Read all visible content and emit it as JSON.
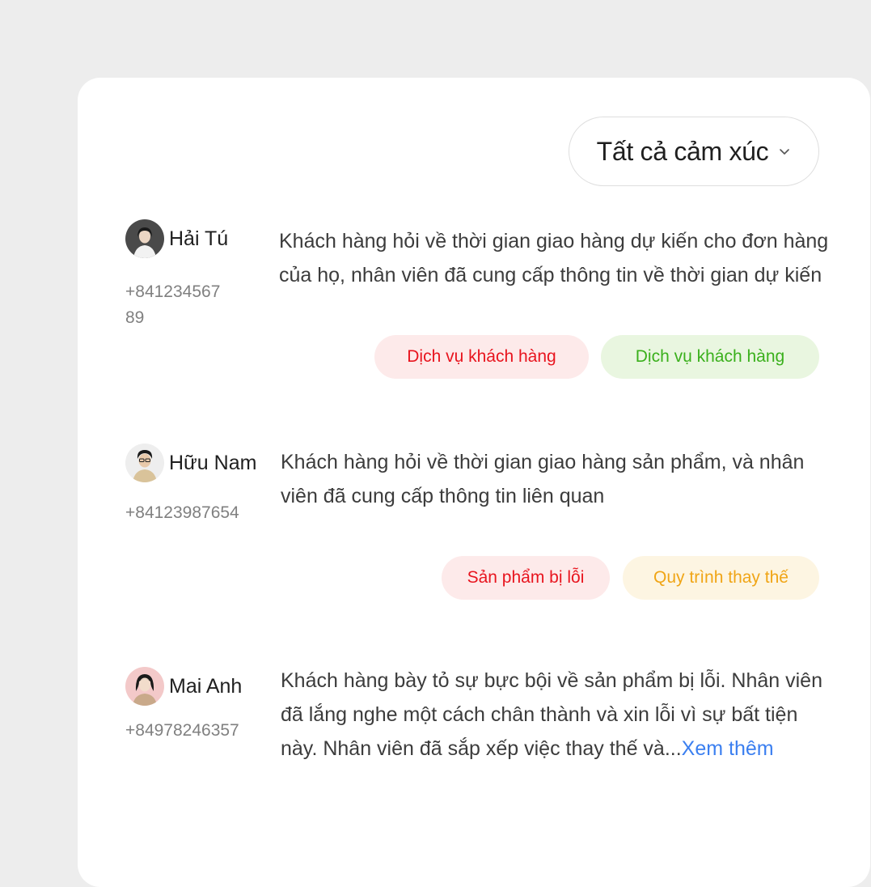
{
  "filter": {
    "label": "Tất cả cảm xúc",
    "icon": "chevron-down-icon"
  },
  "colors": {
    "tag_red_bg": "#fdeaea",
    "tag_red_text": "#e8141e",
    "tag_green_bg": "#e9f6e0",
    "tag_green_text": "#3ab01c",
    "tag_yellow_bg": "#fdf5e2",
    "tag_yellow_text": "#f0a516",
    "link": "#3b7ff0"
  },
  "conversations": [
    {
      "name": "Hải Tú",
      "phone": "+84123456789",
      "summary": "Khách hàng hỏi về thời gian giao hàng dự kiến cho đơn hàng của họ, nhân viên đã cung cấp thông tin về thời gian dự kiến",
      "tags": [
        {
          "label": "Dịch vụ khách hàng",
          "tone": "red"
        },
        {
          "label": "Dịch vụ khách hàng",
          "tone": "green"
        }
      ]
    },
    {
      "name": "Hữu Nam",
      "phone": "+84123987654",
      "summary": "Khách hàng hỏi về thời gian giao hàng sản phẩm, và nhân viên đã cung cấp thông tin liên quan",
      "tags": [
        {
          "label": "Sản phẩm bị lỗi",
          "tone": "red"
        },
        {
          "label": "Quy trình thay thế",
          "tone": "yellow"
        }
      ]
    },
    {
      "name": "Mai Anh",
      "phone": "+84978246357",
      "summary": "Khách hàng bày tỏ sự bực bội về sản phẩm bị lỗi. Nhân viên đã lắng nghe một cách chân thành và xin lỗi vì sự bất tiện này. Nhân viên đã sắp xếp việc thay thế và...",
      "more_label": "Xem thêm",
      "tags": []
    }
  ]
}
